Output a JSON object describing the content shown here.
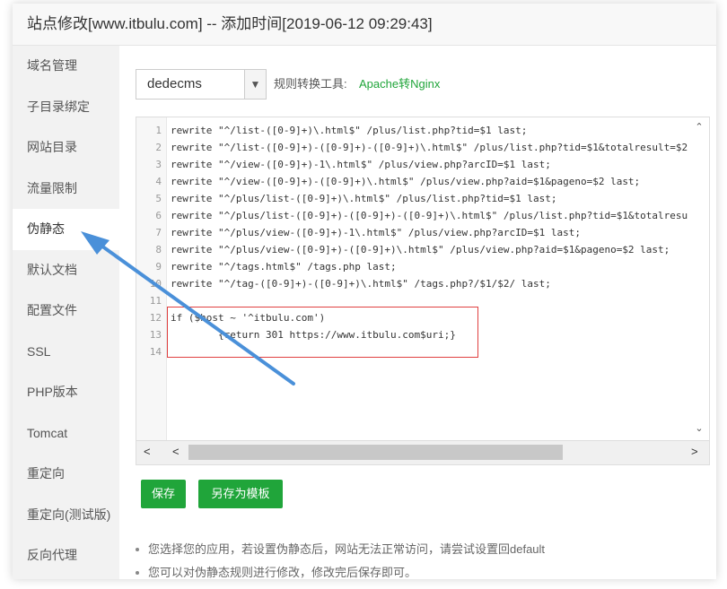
{
  "window": {
    "title": "站点修改[www.itbulu.com] -- 添加时间[2019-06-12 09:29:43]"
  },
  "sidebar": {
    "items": [
      {
        "label": "域名管理",
        "active": false
      },
      {
        "label": "子目录绑定",
        "active": false
      },
      {
        "label": "网站目录",
        "active": false
      },
      {
        "label": "流量限制",
        "active": false
      },
      {
        "label": "伪静态",
        "active": true
      },
      {
        "label": "默认文档",
        "active": false
      },
      {
        "label": "配置文件",
        "active": false
      },
      {
        "label": "SSL",
        "active": false
      },
      {
        "label": "PHP版本",
        "active": false
      },
      {
        "label": "Tomcat",
        "active": false
      },
      {
        "label": "重定向",
        "active": false
      },
      {
        "label": "重定向(测试版)",
        "active": false
      },
      {
        "label": "反向代理",
        "active": false
      }
    ]
  },
  "toolbar": {
    "select_value": "dedecms",
    "select_arrow": "chevron-down-icon",
    "tool_label": "规则转换工具:",
    "tool_link": "Apache转Nginx"
  },
  "editor": {
    "lines": [
      {
        "n": "1",
        "code": "rewrite \"^/list-([0-9]+)\\.html$\" /plus/list.php?tid=$1 last;"
      },
      {
        "n": "2",
        "code": "rewrite \"^/list-([0-9]+)-([0-9]+)-([0-9]+)\\.html$\" /plus/list.php?tid=$1&totalresult=$2"
      },
      {
        "n": "3",
        "code": "rewrite \"^/view-([0-9]+)-1\\.html$\" /plus/view.php?arcID=$1 last;"
      },
      {
        "n": "4",
        "code": "rewrite \"^/view-([0-9]+)-([0-9]+)\\.html$\" /plus/view.php?aid=$1&pageno=$2 last;"
      },
      {
        "n": "5",
        "code": "rewrite \"^/plus/list-([0-9]+)\\.html$\" /plus/list.php?tid=$1 last;"
      },
      {
        "n": "6",
        "code": "rewrite \"^/plus/list-([0-9]+)-([0-9]+)-([0-9]+)\\.html$\" /plus/list.php?tid=$1&totalresu"
      },
      {
        "n": "7",
        "code": "rewrite \"^/plus/view-([0-9]+)-1\\.html$\" /plus/view.php?arcID=$1 last;"
      },
      {
        "n": "8",
        "code": "rewrite \"^/plus/view-([0-9]+)-([0-9]+)\\.html$\" /plus/view.php?aid=$1&pageno=$2 last;"
      },
      {
        "n": "9",
        "code": "rewrite \"^/tags.html$\" /tags.php last;"
      },
      {
        "n": "10",
        "code": "rewrite \"^/tag-([0-9]+)-([0-9]+)\\.html$\" /tags.php?/$1/$2/ last;"
      },
      {
        "n": "11",
        "code": ""
      },
      {
        "n": "12",
        "code": "if ($host ~ '^itbulu.com')"
      },
      {
        "n": "13",
        "code": "        {return 301 https://www.itbulu.com$uri;}"
      },
      {
        "n": "14",
        "code": ""
      }
    ],
    "scroll_up_icon": "chevron-up-icon",
    "scroll_down_icon": "chevron-down-icon",
    "scroll_left_icon": "chevron-left-icon",
    "scroll_right_icon": "chevron-right-icon",
    "highlight_color": "#e04040"
  },
  "buttons": {
    "save": "保存",
    "save_template": "另存为模板"
  },
  "tips": [
    "您选择您的应用，若设置伪静态后，网站无法正常访问，请尝试设置回default",
    "您可以对伪静态规则进行修改，修改完后保存即可。"
  ],
  "colors": {
    "accent": "#20a53a",
    "annotation_arrow": "#4a90d9"
  }
}
